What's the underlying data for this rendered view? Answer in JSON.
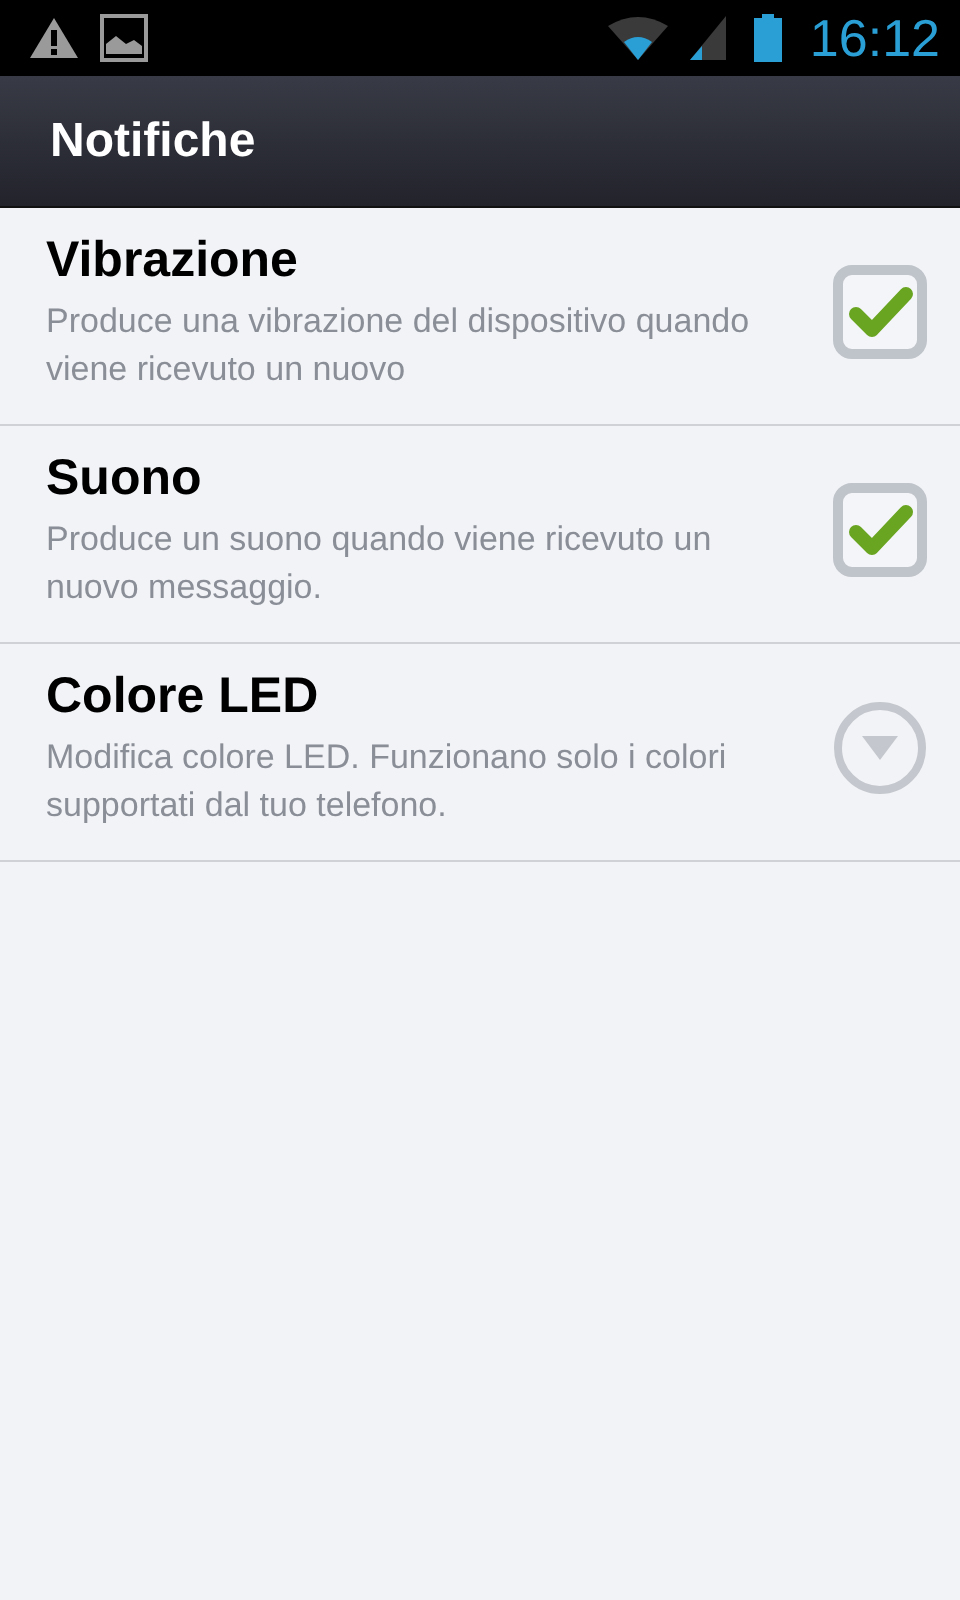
{
  "status_bar": {
    "time": "16:12"
  },
  "action_bar": {
    "title": "Notifiche"
  },
  "settings": [
    {
      "kind": "checkbox",
      "title": "Vibrazione",
      "summary": "Produce una vibrazione del dispositivo quando viene ricevuto un nuovo",
      "checked": true
    },
    {
      "kind": "checkbox",
      "title": "Suono",
      "summary": "Produce un suono quando viene ricevuto un nuovo messaggio.",
      "checked": true
    },
    {
      "kind": "list",
      "title": "Colore LED",
      "summary": "Modifica colore LED. Funzionano solo i colori supportati dal tuo telefono."
    }
  ]
}
